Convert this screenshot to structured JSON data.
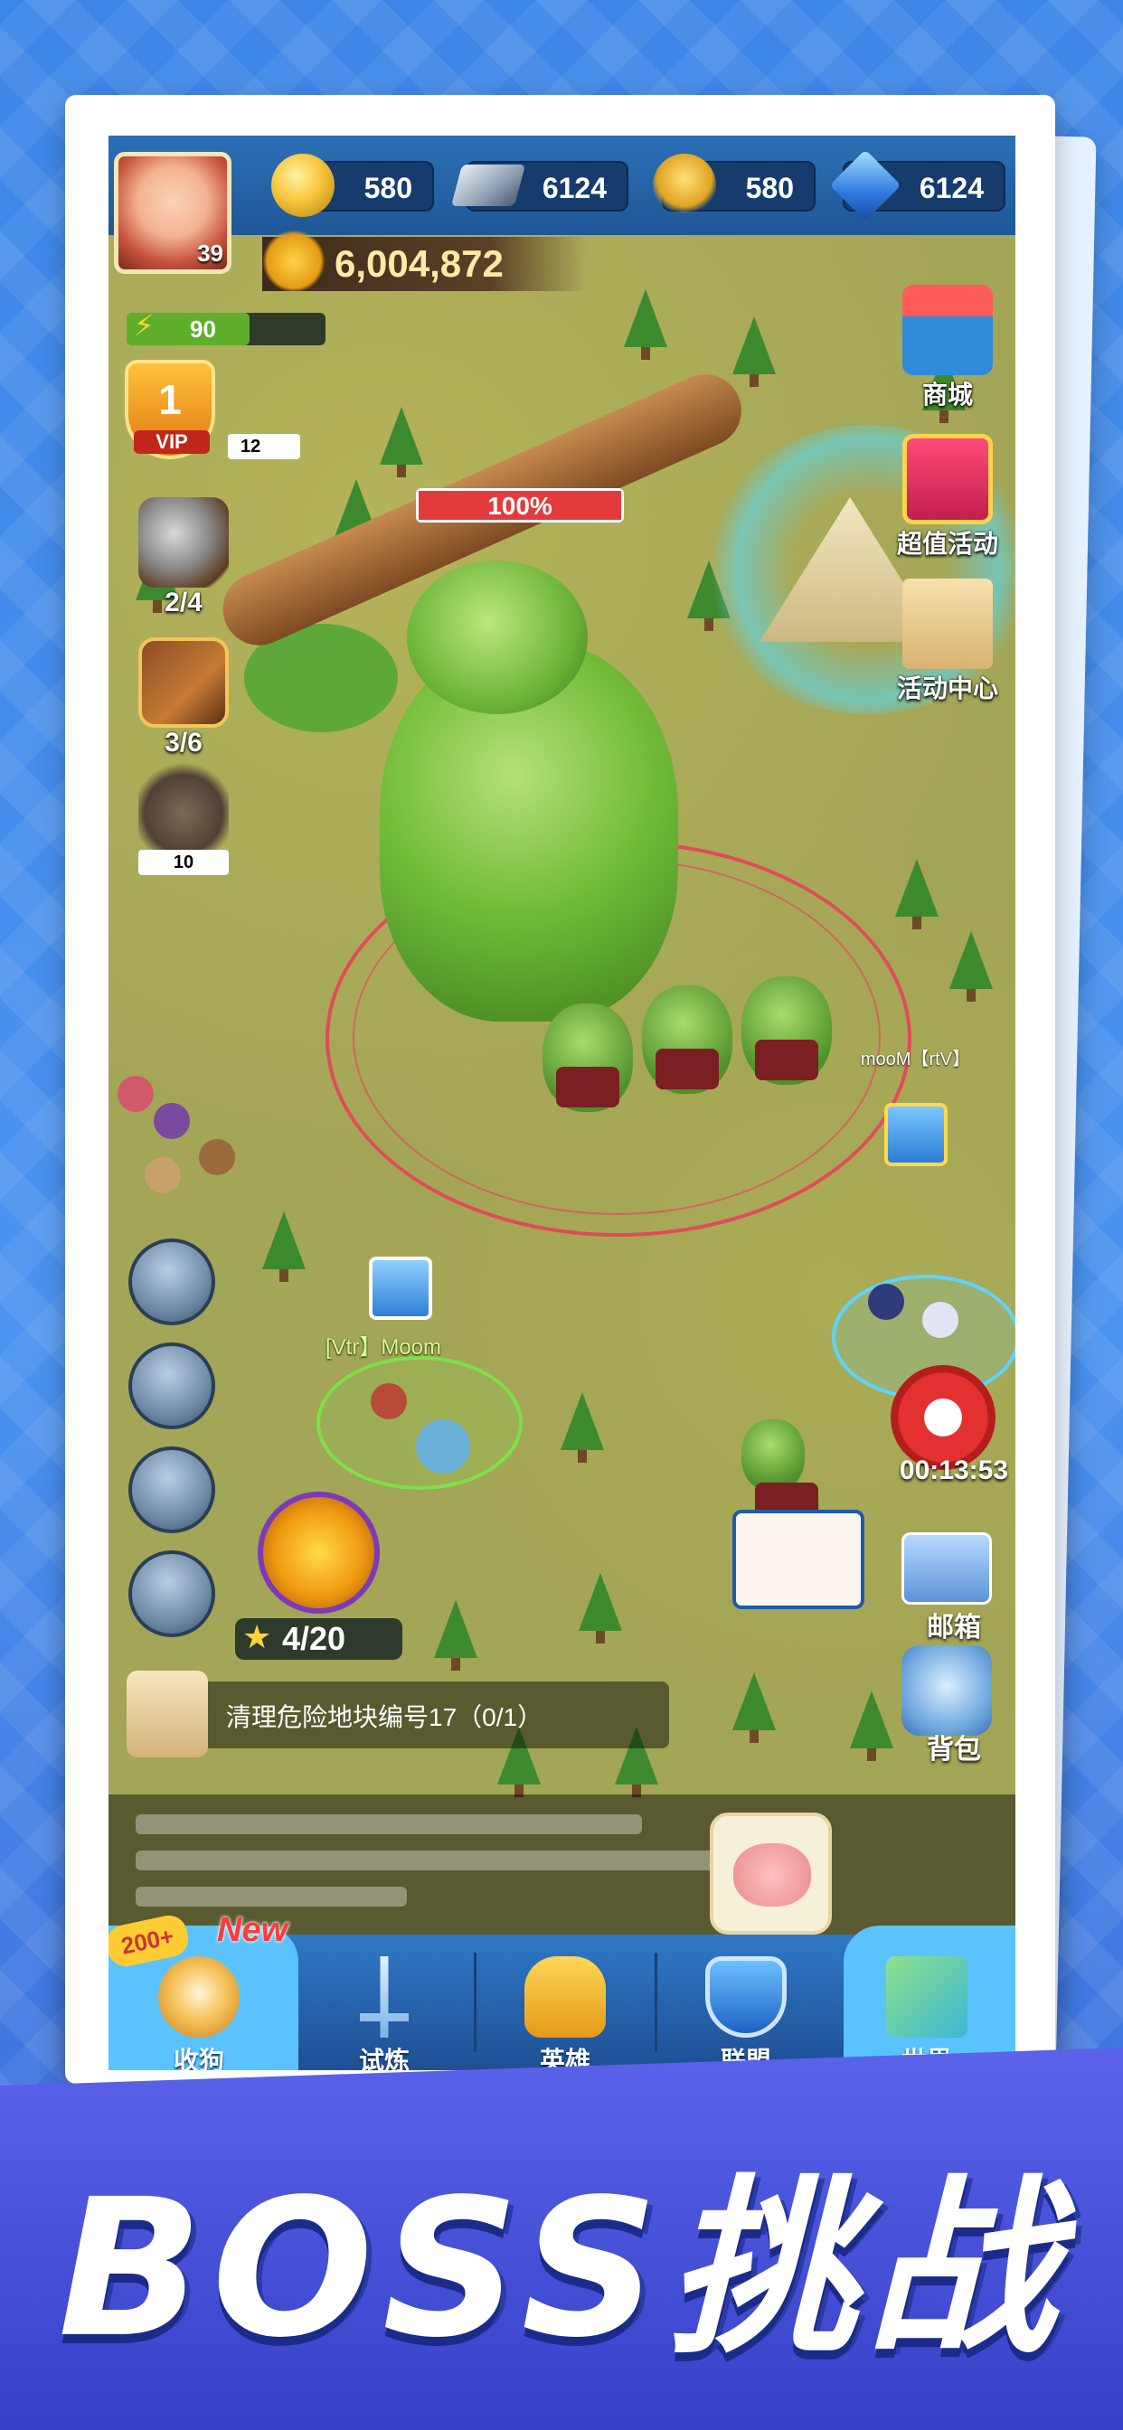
{
  "resources": {
    "gold": "580",
    "iron": "6124",
    "food": "580",
    "gems": "6124"
  },
  "player": {
    "level": "39",
    "power": "6,004,872",
    "energy": "90",
    "vip_level": "1",
    "vip_label": "VIP",
    "vip_points": "12"
  },
  "left_sidebar": [
    {
      "icon": "hammer-icon",
      "label": "2/4"
    },
    {
      "icon": "book-icon",
      "label": "3/6"
    },
    {
      "icon": "mine-icon",
      "label": "10"
    }
  ],
  "right_sidebar": [
    {
      "icon": "shop-icon",
      "label": "商城"
    },
    {
      "icon": "gift-icon",
      "label": "超值活动"
    },
    {
      "icon": "scroll-icon",
      "label": "活动中心"
    }
  ],
  "boss": {
    "hp": "100%",
    "hp_fraction": 1.0
  },
  "map": {
    "enemy_name": "mooM【rtV】",
    "player_name": "[Vtr】Moom",
    "timer": "00:13:53",
    "stars": "4/20"
  },
  "right_bottom": {
    "mail_label": "邮箱",
    "bag_label": "背包"
  },
  "quest": {
    "text": "清理危险地块编号17（0/1）"
  },
  "nav": {
    "badge": "200+",
    "new_tag": "New",
    "items": [
      {
        "icon": "shiba-icon",
        "label": "收狗"
      },
      {
        "icon": "sword-icon",
        "label": "试炼"
      },
      {
        "icon": "helmet-icon",
        "label": "英雄"
      },
      {
        "icon": "shield-icon",
        "label": "联盟"
      },
      {
        "icon": "map-icon",
        "label": "世界"
      }
    ]
  },
  "banner": {
    "title": "BOSS挑战"
  },
  "colors": {
    "background": "#4a93f0",
    "nav": "#2f78c6",
    "boss_hp": "#e33b3b",
    "banner": "#4650d8"
  }
}
